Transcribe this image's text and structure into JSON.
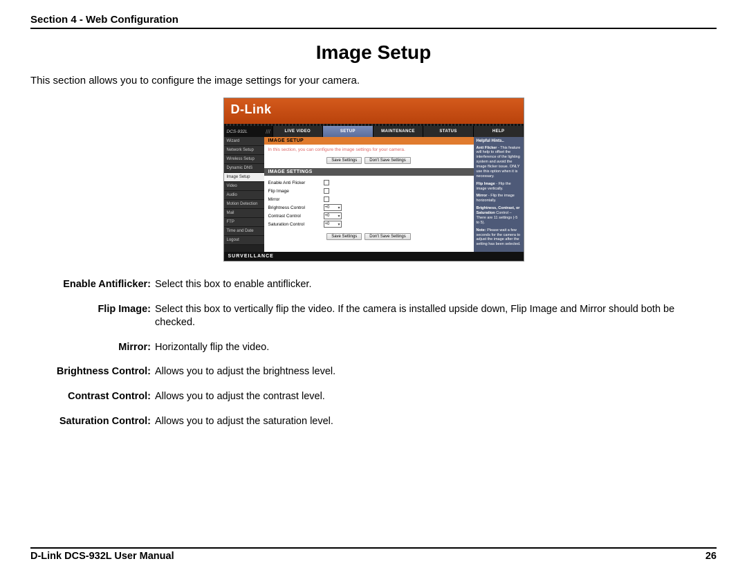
{
  "header": {
    "section": "Section 4 - Web Configuration"
  },
  "title": "Image Setup",
  "intro": "This section allows you to configure the image settings for your camera.",
  "shot": {
    "brand": "D-Link",
    "model": "DCS-932L",
    "nav": [
      "LIVE VIDEO",
      "SETUP",
      "MAINTENANCE",
      "STATUS",
      "HELP"
    ],
    "nav_active": "SETUP",
    "sidebar": [
      "Wizard",
      "Network Setup",
      "Wireless Setup",
      "Dynamic DNS",
      "Image Setup",
      "Video",
      "Audio",
      "Motion Detection",
      "Mail",
      "FTP",
      "Time and Date",
      "Logout"
    ],
    "sidebar_active": "Image Setup",
    "section_title": "IMAGE SETUP",
    "section_note": "In this section, you can configure the image settings for your camera.",
    "save": "Save Settings",
    "dontsave": "Don't Save Settings",
    "settings_title": "IMAGE SETTINGS",
    "rows": {
      "antiflicker": "Enable Anti Flicker",
      "flip": "Flip Image",
      "mirror": "Mirror",
      "brightness": "Brightness Control",
      "contrast": "Contrast Control",
      "saturation": "Saturation Control"
    },
    "select_value": "+0",
    "hints": {
      "title": "Helpful Hints..",
      "p1b": "Anti Flicker",
      "p1": " - This feature will help to offset the interference of the lighting system and avoid the image flicker issue. ONLY use this option when it is necessary.",
      "p2b": "Flip Image",
      "p2": " - Flip the image vertically.",
      "p3b": "Mirror",
      "p3": " - Flip the image horizontally.",
      "p4b": "Brightness, Contrast, or Saturation",
      "p4": " Control – There are 11 settings (-5 to 5).",
      "p5b": "Note:",
      "p5": " Please wait a few seconds for the camera to adjust the image after the setting has been selected."
    },
    "footer": "SURVEILLANCE"
  },
  "defs": [
    {
      "label": "Enable Antiflicker:",
      "text": "Select this box to enable antiflicker."
    },
    {
      "label": "Flip Image:",
      "text": "Select this box to vertically flip the video. If the camera is installed upside down, Flip Image and Mirror should both be checked."
    },
    {
      "label": "Mirror:",
      "text": "Horizontally flip the video."
    },
    {
      "label": "Brightness Control:",
      "text": "Allows you to adjust the brightness level."
    },
    {
      "label": "Contrast Control:",
      "text": "Allows you to adjust the contrast level."
    },
    {
      "label": "Saturation Control:",
      "text": "Allows you to adjust the saturation level."
    }
  ],
  "footer": {
    "manual": "D-Link DCS-932L User Manual",
    "page": "26"
  }
}
